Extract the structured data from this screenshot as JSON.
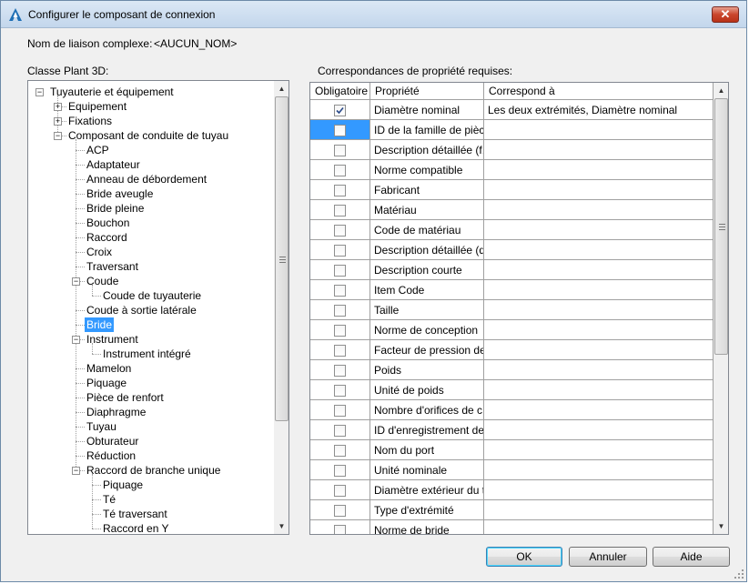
{
  "window": {
    "title": "Configurer le composant de connexion",
    "close_symbol": "✕"
  },
  "complex_link": {
    "label": "Nom de liaison complexe:",
    "value": "<AUCUN_NOM>"
  },
  "tree": {
    "label": "Classe Plant 3D:",
    "items": [
      {
        "label": "Tuyauterie et équipement",
        "expander": "−"
      },
      {
        "label": "Equipement",
        "expander": "+"
      },
      {
        "label": "Fixations",
        "expander": "+"
      },
      {
        "label": "Composant de conduite de tuyau",
        "expander": "−"
      },
      {
        "label": "ACP"
      },
      {
        "label": "Adaptateur"
      },
      {
        "label": "Anneau de débordement"
      },
      {
        "label": "Bride aveugle"
      },
      {
        "label": "Bride pleine"
      },
      {
        "label": "Bouchon"
      },
      {
        "label": "Raccord"
      },
      {
        "label": "Croix"
      },
      {
        "label": "Traversant"
      },
      {
        "label": "Coude",
        "expander": "−"
      },
      {
        "label": "Coude de tuyauterie"
      },
      {
        "label": "Coude à sortie latérale"
      },
      {
        "label": "Bride",
        "selected": true
      },
      {
        "label": "Instrument",
        "expander": "−"
      },
      {
        "label": "Instrument intégré"
      },
      {
        "label": "Mamelon"
      },
      {
        "label": "Piquage"
      },
      {
        "label": "Pièce de renfort"
      },
      {
        "label": "Diaphragme"
      },
      {
        "label": "Tuyau"
      },
      {
        "label": "Obturateur"
      },
      {
        "label": "Réduction"
      },
      {
        "label": "Raccord de branche unique",
        "expander": "−"
      },
      {
        "label": "Piquage"
      },
      {
        "label": "Té"
      },
      {
        "label": "Té traversant"
      },
      {
        "label": "Raccord en Y"
      }
    ]
  },
  "grid": {
    "label": "Correspondances de propriété requises:",
    "headers": [
      "Obligatoire",
      "Propriété",
      "Correspond à"
    ],
    "rows": [
      {
        "checked": true,
        "property": "Diamètre nominal",
        "maps_to": "Les deux extrémités, Diamètre nominal"
      },
      {
        "checked": false,
        "property": "ID de la famille de pièc...",
        "maps_to": "",
        "selected": true
      },
      {
        "checked": false,
        "property": "Description détaillée (f...",
        "maps_to": ""
      },
      {
        "checked": false,
        "property": "Norme compatible",
        "maps_to": ""
      },
      {
        "checked": false,
        "property": "Fabricant",
        "maps_to": ""
      },
      {
        "checked": false,
        "property": "Matériau",
        "maps_to": ""
      },
      {
        "checked": false,
        "property": "Code de matériau",
        "maps_to": ""
      },
      {
        "checked": false,
        "property": "Description détaillée (d...",
        "maps_to": ""
      },
      {
        "checked": false,
        "property": "Description courte",
        "maps_to": ""
      },
      {
        "checked": false,
        "property": "Item Code",
        "maps_to": ""
      },
      {
        "checked": false,
        "property": "Taille",
        "maps_to": ""
      },
      {
        "checked": false,
        "property": "Norme de conception",
        "maps_to": ""
      },
      {
        "checked": false,
        "property": "Facteur de pression de...",
        "maps_to": ""
      },
      {
        "checked": false,
        "property": "Poids",
        "maps_to": ""
      },
      {
        "checked": false,
        "property": "Unité de poids",
        "maps_to": ""
      },
      {
        "checked": false,
        "property": "Nombre d'orifices de c...",
        "maps_to": ""
      },
      {
        "checked": false,
        "property": "ID d'enregistrement de...",
        "maps_to": ""
      },
      {
        "checked": false,
        "property": "Nom du port",
        "maps_to": ""
      },
      {
        "checked": false,
        "property": "Unité nominale",
        "maps_to": ""
      },
      {
        "checked": false,
        "property": "Diamètre extérieur du t...",
        "maps_to": ""
      },
      {
        "checked": false,
        "property": "Type d'extrémité",
        "maps_to": ""
      },
      {
        "checked": false,
        "property": "Norme de bride",
        "maps_to": ""
      }
    ]
  },
  "buttons": {
    "ok": "OK",
    "cancel": "Annuler",
    "help": "Aide"
  },
  "colors": {
    "selection": "#3399ff",
    "close_button": "#c9452c"
  }
}
